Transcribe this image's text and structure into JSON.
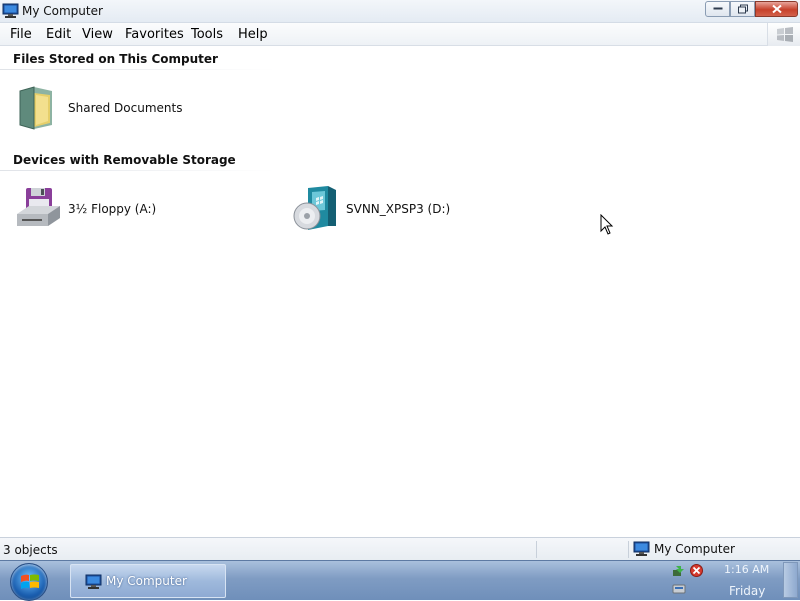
{
  "window": {
    "title": "My Computer",
    "icon": "computer-icon"
  },
  "menu": {
    "items": [
      "File",
      "Edit",
      "View",
      "Favorites",
      "Tools",
      "Help"
    ]
  },
  "content": {
    "groups": [
      {
        "header": "Files Stored on This Computer",
        "items": [
          {
            "label": "Shared Documents",
            "icon": "folder-icon"
          }
        ]
      },
      {
        "header": "Devices with Removable Storage",
        "items": [
          {
            "label": "3½ Floppy (A:)",
            "icon": "floppy-drive-icon"
          },
          {
            "label": "SVNN_XPSP3 (D:)",
            "icon": "cd-drive-icon"
          }
        ]
      }
    ]
  },
  "statusbar": {
    "objects": "3 objects",
    "zone": "My Computer"
  },
  "taskbar": {
    "task_button": "My Computer",
    "clock_time": "1:16 AM",
    "clock_day": "Friday"
  },
  "colors": {
    "taskbar": "#7f9cc3",
    "close_button": "#c7412b"
  }
}
